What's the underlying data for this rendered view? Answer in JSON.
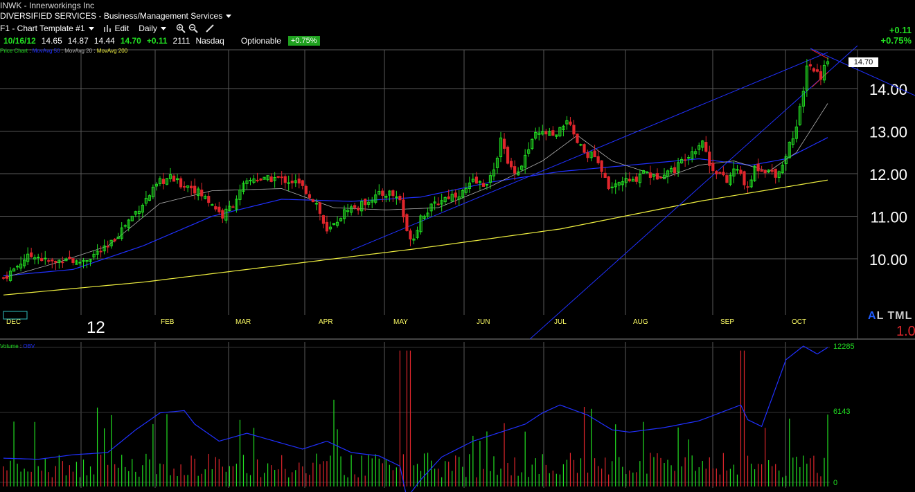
{
  "header": {
    "symbol_line": "INWK - Innerworkings Inc",
    "sector": "DIVERSIFIED SERVICES - Business/Management Services",
    "template": "F1 - Chart Template #1",
    "edit_label": "Edit",
    "period_label": "Daily",
    "date": "10/16/12",
    "open": "14.65",
    "high": "14.87",
    "low": "14.44",
    "close": "14.70",
    "change": "+0.11",
    "volume": "2111",
    "exchange": "Nasdaq",
    "optionable": "Optionable",
    "change_pct": "+0.75%",
    "top_right_change": "+0.11",
    "top_right_pct": "+0.75%"
  },
  "legend": {
    "price_chart": "Price Chart",
    "ma50": "MovAvg 50",
    "ma20": "MovAvg 20",
    "ma200": "MovAvg 200",
    "volume": "Volume",
    "obv": "OBV"
  },
  "logo": {
    "a": "A",
    "rest": "L TML",
    "sub": "1.0"
  },
  "year_label": "12",
  "last_price_tag": "14.70",
  "colors": {
    "up": "#22e022",
    "down": "#e0262c",
    "ma20": "#b0b0b0",
    "ma50": "#2030ff",
    "ma200": "#f0f040",
    "obv": "#2030ff",
    "grid": "#5a5a5a"
  },
  "chart_data": {
    "type": "candlestick",
    "y_axis": {
      "ticks": [
        14.0,
        13.0,
        12.0,
        11.0,
        10.0
      ],
      "tick_labels": [
        "14.00",
        "13.00",
        "12.00",
        "11.00",
        "10.00"
      ]
    },
    "x_axis": {
      "months": [
        "DEC",
        "FEB",
        "MAR",
        "APR",
        "MAY",
        "JUN",
        "JUL",
        "AUG",
        "SEP",
        "OCT"
      ]
    },
    "volume_axis": {
      "tick_labels": [
        "12285",
        "6143",
        "0"
      ],
      "ticks": [
        12285,
        6143,
        0
      ]
    },
    "price_anchors": [
      [
        0,
        9.55
      ],
      [
        3,
        9.75
      ],
      [
        6,
        10.0
      ],
      [
        9,
        10.1
      ],
      [
        12,
        9.95
      ],
      [
        15,
        9.9
      ],
      [
        18,
        10.05
      ],
      [
        21,
        9.9
      ],
      [
        24,
        10.0
      ],
      [
        27,
        10.15
      ],
      [
        30,
        10.25
      ],
      [
        33,
        10.6
      ],
      [
        36,
        10.9
      ],
      [
        39,
        11.2
      ],
      [
        42,
        11.5
      ],
      [
        45,
        11.8
      ],
      [
        48,
        11.9
      ],
      [
        51,
        11.75
      ],
      [
        54,
        11.7
      ],
      [
        57,
        11.5
      ],
      [
        60,
        11.3
      ],
      [
        63,
        11.0
      ],
      [
        66,
        11.3
      ],
      [
        69,
        11.7
      ],
      [
        72,
        11.9
      ],
      [
        75,
        11.85
      ],
      [
        78,
        11.9
      ],
      [
        81,
        11.85
      ],
      [
        84,
        11.8
      ],
      [
        87,
        11.6
      ],
      [
        90,
        11.3
      ],
      [
        93,
        10.6
      ],
      [
        96,
        10.9
      ],
      [
        99,
        11.2
      ],
      [
        102,
        11.2
      ],
      [
        105,
        11.4
      ],
      [
        108,
        11.5
      ],
      [
        111,
        11.55
      ],
      [
        114,
        11.4
      ],
      [
        116,
        10.6
      ],
      [
        118,
        10.5
      ],
      [
        120,
        11.0
      ],
      [
        123,
        11.2
      ],
      [
        126,
        11.4
      ],
      [
        129,
        11.5
      ],
      [
        132,
        11.55
      ],
      [
        135,
        11.8
      ],
      [
        138,
        11.75
      ],
      [
        141,
        12.0
      ],
      [
        143,
        12.9
      ],
      [
        145,
        12.2
      ],
      [
        148,
        12.05
      ],
      [
        150,
        12.4
      ],
      [
        153,
        12.9
      ],
      [
        156,
        12.95
      ],
      [
        159,
        12.85
      ],
      [
        162,
        13.3
      ],
      [
        164,
        12.85
      ],
      [
        167,
        12.5
      ],
      [
        170,
        12.4
      ],
      [
        172,
        12.0
      ],
      [
        175,
        11.6
      ],
      [
        178,
        11.85
      ],
      [
        181,
        11.8
      ],
      [
        184,
        12.1
      ],
      [
        187,
        11.9
      ],
      [
        190,
        12.05
      ],
      [
        193,
        12.1
      ],
      [
        196,
        12.4
      ],
      [
        199,
        12.6
      ],
      [
        201,
        12.8
      ],
      [
        203,
        12.2
      ],
      [
        206,
        12.0
      ],
      [
        208,
        11.8
      ],
      [
        210,
        12.1
      ],
      [
        212,
        12.0
      ],
      [
        214,
        11.6
      ],
      [
        216,
        12.15
      ],
      [
        219,
        12.1
      ],
      [
        222,
        12.0
      ],
      [
        224,
        12.2
      ],
      [
        226,
        12.7
      ],
      [
        228,
        13.1
      ],
      [
        230,
        13.9
      ],
      [
        231,
        14.6
      ],
      [
        233,
        14.45
      ],
      [
        235,
        14.3
      ],
      [
        237,
        14.7
      ]
    ],
    "ma200_anchors": [
      [
        0,
        9.15
      ],
      [
        40,
        9.45
      ],
      [
        80,
        9.85
      ],
      [
        120,
        10.25
      ],
      [
        160,
        10.7
      ],
      [
        200,
        11.35
      ],
      [
        237,
        11.85
      ]
    ],
    "ma50_anchors": [
      [
        0,
        9.6
      ],
      [
        20,
        9.75
      ],
      [
        40,
        10.3
      ],
      [
        60,
        11.0
      ],
      [
        80,
        11.4
      ],
      [
        100,
        11.35
      ],
      [
        120,
        11.45
      ],
      [
        140,
        11.8
      ],
      [
        160,
        12.05
      ],
      [
        180,
        12.2
      ],
      [
        200,
        12.35
      ],
      [
        215,
        12.2
      ],
      [
        225,
        12.35
      ],
      [
        237,
        12.85
      ]
    ],
    "ma20_anchors": [
      [
        0,
        9.55
      ],
      [
        15,
        9.9
      ],
      [
        30,
        10.3
      ],
      [
        45,
        11.3
      ],
      [
        60,
        11.6
      ],
      [
        80,
        11.65
      ],
      [
        95,
        11.2
      ],
      [
        110,
        11.15
      ],
      [
        125,
        11.2
      ],
      [
        140,
        11.7
      ],
      [
        155,
        12.3
      ],
      [
        165,
        12.9
      ],
      [
        175,
        12.3
      ],
      [
        190,
        11.9
      ],
      [
        200,
        12.2
      ],
      [
        210,
        12.3
      ],
      [
        220,
        12.05
      ],
      [
        228,
        12.5
      ],
      [
        237,
        13.65
      ]
    ],
    "obv_anchors": [
      [
        0,
        2500
      ],
      [
        10,
        2400
      ],
      [
        20,
        2800
      ],
      [
        30,
        3000
      ],
      [
        38,
        5000
      ],
      [
        45,
        6500
      ],
      [
        52,
        6700
      ],
      [
        55,
        5500
      ],
      [
        62,
        4000
      ],
      [
        70,
        4700
      ],
      [
        78,
        4000
      ],
      [
        86,
        3300
      ],
      [
        93,
        4000
      ],
      [
        100,
        3000
      ],
      [
        108,
        2700
      ],
      [
        114,
        1800
      ],
      [
        116,
        -1000
      ],
      [
        120,
        600
      ],
      [
        126,
        2600
      ],
      [
        135,
        4000
      ],
      [
        143,
        4800
      ],
      [
        150,
        5500
      ],
      [
        155,
        6500
      ],
      [
        160,
        7200
      ],
      [
        168,
        6300
      ],
      [
        175,
        5000
      ],
      [
        180,
        4800
      ],
      [
        190,
        5200
      ],
      [
        200,
        5800
      ],
      [
        206,
        6500
      ],
      [
        212,
        7200
      ],
      [
        214,
        5900
      ],
      [
        218,
        5300
      ],
      [
        225,
        11200
      ],
      [
        230,
        12400
      ],
      [
        234,
        11700
      ],
      [
        237,
        12285
      ]
    ],
    "trendline_up": [
      [
        100.0,
        10.2
      ],
      [
        237,
        14.85
      ]
    ],
    "trendline_down": [
      [
        228,
        14.95
      ],
      [
        237,
        13.8
      ]
    ]
  }
}
